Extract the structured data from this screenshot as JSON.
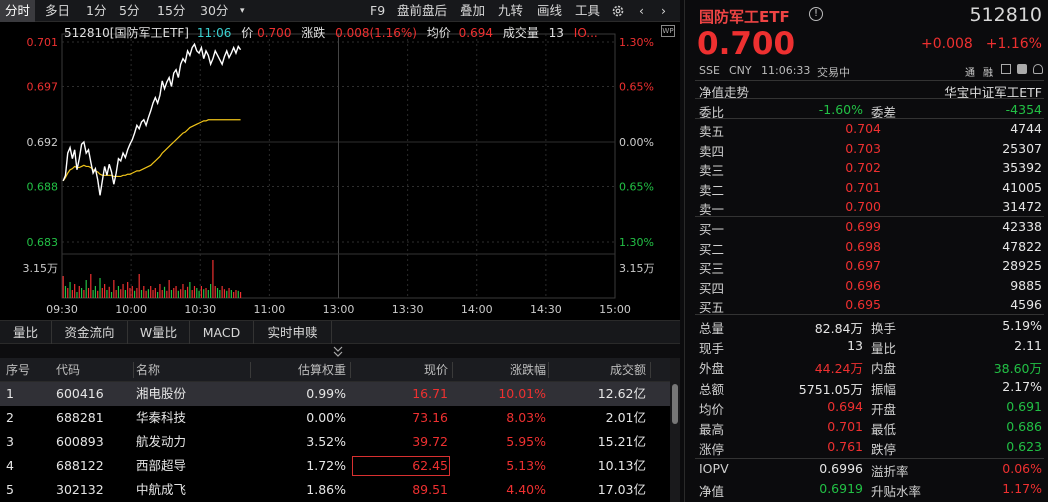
{
  "toolbar": {
    "tabs": [
      "分时",
      "多日",
      "1分",
      "5分",
      "15分",
      "30分"
    ],
    "dropdown_icon": "caret-down",
    "right_items": [
      "F9",
      "盘前盘后",
      "叠加",
      "九转",
      "画线",
      "工具"
    ],
    "gear_icon": "gear",
    "back_icon": "chevron-left",
    "forward_icon": "chevron-right"
  },
  "chart_header": {
    "name": "512810[国防军工ETF]",
    "time": "11:06",
    "price_label": "价",
    "price": "0.700",
    "change_label": "涨跌",
    "change": "0.008(1.16%)",
    "avg_label": "均价",
    "avg": "0.694",
    "volume_label": "成交量",
    "volume": "13",
    "volume_more": "IO..."
  },
  "chart_data": {
    "type": "line",
    "y_left_ticks": [
      "0.701",
      "0.697",
      "0.692",
      "0.688",
      "0.683"
    ],
    "y_right_ticks": [
      "1.30%",
      "0.65%",
      "0.00%",
      "0.65%",
      "1.30%"
    ],
    "volume_ticks": [
      "3.15万",
      "3.15万"
    ],
    "x_ticks": [
      "09:30",
      "10:00",
      "10:30",
      "11:00",
      "13:00",
      "13:30",
      "14:00",
      "14:30",
      "15:00"
    ],
    "ylim": [
      0.683,
      0.701
    ],
    "prev_close": 0.692,
    "colors": {
      "price": "#ffffff",
      "avg": "#f0c419",
      "up": "#ee3030",
      "down": "#22c045",
      "grid": "#333333"
    },
    "series": [
      {
        "name": "价",
        "values": [
          0.6885,
          0.689,
          0.691,
          0.6915,
          0.6905,
          0.6913,
          0.6895,
          0.6905,
          0.6918,
          0.692,
          0.691,
          0.6913,
          0.6902,
          0.6892,
          0.6896,
          0.6886,
          0.6872,
          0.6885,
          0.6898,
          0.689,
          0.69,
          0.6893,
          0.6882,
          0.6892,
          0.6905,
          0.6903,
          0.691,
          0.6906,
          0.6913,
          0.6918,
          0.6922,
          0.6928,
          0.6935,
          0.6932,
          0.6938,
          0.694,
          0.6935,
          0.6942,
          0.6948,
          0.6955,
          0.696,
          0.6955,
          0.6962,
          0.6975,
          0.6968,
          0.6974,
          0.6978,
          0.697,
          0.6982,
          0.6985,
          0.6978,
          0.699,
          0.6995,
          0.6992,
          0.7002,
          0.6998,
          0.7005,
          0.7008,
          0.7002,
          0.7,
          0.7005,
          0.6995,
          0.7002,
          0.6998,
          0.699,
          0.6995,
          0.7002,
          0.6998,
          0.6994,
          0.699,
          0.6997,
          0.7002,
          0.6996,
          0.7,
          0.7005,
          0.7,
          0.7006,
          0.7003
        ]
      },
      {
        "name": "均价",
        "values": [
          0.6885,
          0.6888,
          0.6892,
          0.6895,
          0.6896,
          0.6898,
          0.6897,
          0.6897,
          0.6898,
          0.6899,
          0.6898,
          0.6898,
          0.6897,
          0.6895,
          0.6894,
          0.6893,
          0.6891,
          0.689,
          0.689,
          0.689,
          0.689,
          0.689,
          0.6889,
          0.6889,
          0.6889,
          0.6889,
          0.689,
          0.689,
          0.6891,
          0.6891,
          0.6892,
          0.6893,
          0.6894,
          0.6894,
          0.6895,
          0.6896,
          0.6897,
          0.6898,
          0.6899,
          0.6901,
          0.6903,
          0.6905,
          0.6907,
          0.691,
          0.6912,
          0.6914,
          0.6916,
          0.6918,
          0.692,
          0.6922,
          0.6924,
          0.6926,
          0.6928,
          0.6929,
          0.6931,
          0.6933,
          0.6934,
          0.6935,
          0.6936,
          0.6937,
          0.6938,
          0.6939,
          0.6939,
          0.694,
          0.694,
          0.694,
          0.694,
          0.694,
          0.694,
          0.694,
          0.694,
          0.694,
          0.694,
          0.694,
          0.694,
          0.694,
          0.694,
          0.694
        ]
      }
    ],
    "volume_bars": [
      0.55,
      0.3,
      0.25,
      0.4,
      0.2,
      0.35,
      0.15,
      0.3,
      0.25,
      0.2,
      0.45,
      0.25,
      0.6,
      0.2,
      0.3,
      0.18,
      0.5,
      0.25,
      0.35,
      0.2,
      0.28,
      0.15,
      0.45,
      0.2,
      0.3,
      0.22,
      0.35,
      0.2,
      0.4,
      0.25,
      0.3,
      0.18,
      0.25,
      0.6,
      0.2,
      0.3,
      0.18,
      0.22,
      0.3,
      0.2,
      0.25,
      0.15,
      0.35,
      0.2,
      0.28,
      0.18,
      0.45,
      0.2,
      0.25,
      0.3,
      0.18,
      0.22,
      0.35,
      0.2,
      0.28,
      0.4,
      0.2,
      0.3,
      0.25,
      0.18,
      0.3,
      0.22,
      0.25,
      0.2,
      0.35,
      0.95,
      0.3,
      0.25,
      0.2,
      0.3,
      0.22,
      0.18,
      0.25,
      0.2,
      0.15,
      0.2,
      0.18,
      0.15
    ],
    "volume_colors": [
      1,
      0,
      1,
      0,
      1,
      1,
      0,
      1,
      0,
      1,
      0,
      1,
      1,
      0,
      0,
      1,
      0,
      1,
      1,
      0,
      1,
      0,
      1,
      1,
      0,
      1,
      1,
      0,
      1,
      1,
      1,
      0,
      1,
      1,
      0,
      1,
      1,
      0,
      1,
      1,
      1,
      0,
      1,
      1,
      0,
      1,
      1,
      0,
      1,
      1,
      0,
      1,
      1,
      0,
      1,
      0,
      1,
      1,
      0,
      0,
      1,
      0,
      1,
      0,
      0,
      1,
      1,
      0,
      0,
      1,
      1,
      0,
      1,
      0,
      1,
      1,
      0,
      1
    ]
  },
  "subtabs": [
    "量比",
    "资金流向",
    "W量比",
    "MACD",
    "实时申赎"
  ],
  "table": {
    "headers": [
      "序号",
      "代码",
      "名称",
      "估算权重",
      "现价",
      "涨跌幅",
      "成交额"
    ],
    "rows": [
      [
        "1",
        "600416",
        "湘电股份",
        "0.99%",
        "16.71",
        "10.01%",
        "12.62亿"
      ],
      [
        "2",
        "688281",
        "华秦科技",
        "0.00%",
        "73.16",
        "8.03%",
        "2.01亿"
      ],
      [
        "3",
        "600893",
        "航发动力",
        "3.52%",
        "39.72",
        "5.95%",
        "15.21亿"
      ],
      [
        "4",
        "688122",
        "西部超导",
        "1.72%",
        "62.45",
        "5.13%",
        "10.13亿"
      ],
      [
        "5",
        "302132",
        "中航成飞",
        "1.86%",
        "89.51",
        "4.40%",
        "17.03亿"
      ]
    ]
  },
  "quote": {
    "name": "国防军工ETF",
    "code": "512810",
    "price": "0.700",
    "change": "+0.008",
    "change_pct": "+1.16%",
    "market": "SSE",
    "currency": "CNY",
    "time": "11:06:33",
    "status": "交易中",
    "badges": [
      "通",
      "融"
    ],
    "nav_trend": "净值走势",
    "tracking": "华宝中证军工ETF",
    "webi_label": "委比",
    "webi": "-1.60%",
    "weicha_label": "委差",
    "weicha": "-4354"
  },
  "asks": [
    {
      "label": "卖五",
      "price": "0.704",
      "vol": "4744"
    },
    {
      "label": "卖四",
      "price": "0.703",
      "vol": "25307"
    },
    {
      "label": "卖三",
      "price": "0.702",
      "vol": "35392"
    },
    {
      "label": "卖二",
      "price": "0.701",
      "vol": "41005"
    },
    {
      "label": "卖一",
      "price": "0.700",
      "vol": "31472"
    }
  ],
  "bids": [
    {
      "label": "买一",
      "price": "0.699",
      "vol": "42338"
    },
    {
      "label": "买二",
      "price": "0.698",
      "vol": "47822"
    },
    {
      "label": "买三",
      "price": "0.697",
      "vol": "28925"
    },
    {
      "label": "买四",
      "price": "0.696",
      "vol": "9885"
    },
    {
      "label": "买五",
      "price": "0.695",
      "vol": "4596"
    }
  ],
  "stats": [
    {
      "l": "总量",
      "v": "82.84万",
      "vc": "wht",
      "l2": "换手",
      "v2": "5.19%",
      "v2c": "wht"
    },
    {
      "l": "现手",
      "v": "13",
      "vc": "wht",
      "l2": "量比",
      "v2": "2.11",
      "v2c": "wht"
    },
    {
      "l": "外盘",
      "v": "44.24万",
      "vc": "red",
      "l2": "内盘",
      "v2": "38.60万",
      "v2c": "grn"
    },
    {
      "l": "总额",
      "v": "5751.05万",
      "vc": "wht",
      "l2": "振幅",
      "v2": "2.17%",
      "v2c": "wht"
    },
    {
      "l": "均价",
      "v": "0.694",
      "vc": "red",
      "l2": "开盘",
      "v2": "0.691",
      "v2c": "grn"
    },
    {
      "l": "最高",
      "v": "0.701",
      "vc": "red",
      "l2": "最低",
      "v2": "0.686",
      "v2c": "grn"
    },
    {
      "l": "涨停",
      "v": "0.761",
      "vc": "red",
      "l2": "跌停",
      "v2": "0.623",
      "v2c": "grn"
    }
  ],
  "bottom": [
    {
      "l": "IOPV",
      "v": "0.6996",
      "vc": "wht",
      "l2": "溢折率",
      "v2": "0.06%",
      "v2c": "red"
    },
    {
      "l": "净值",
      "v": "0.6919",
      "vc": "grn",
      "l2": "升贴水率",
      "v2": "1.17%",
      "v2c": "red"
    }
  ]
}
